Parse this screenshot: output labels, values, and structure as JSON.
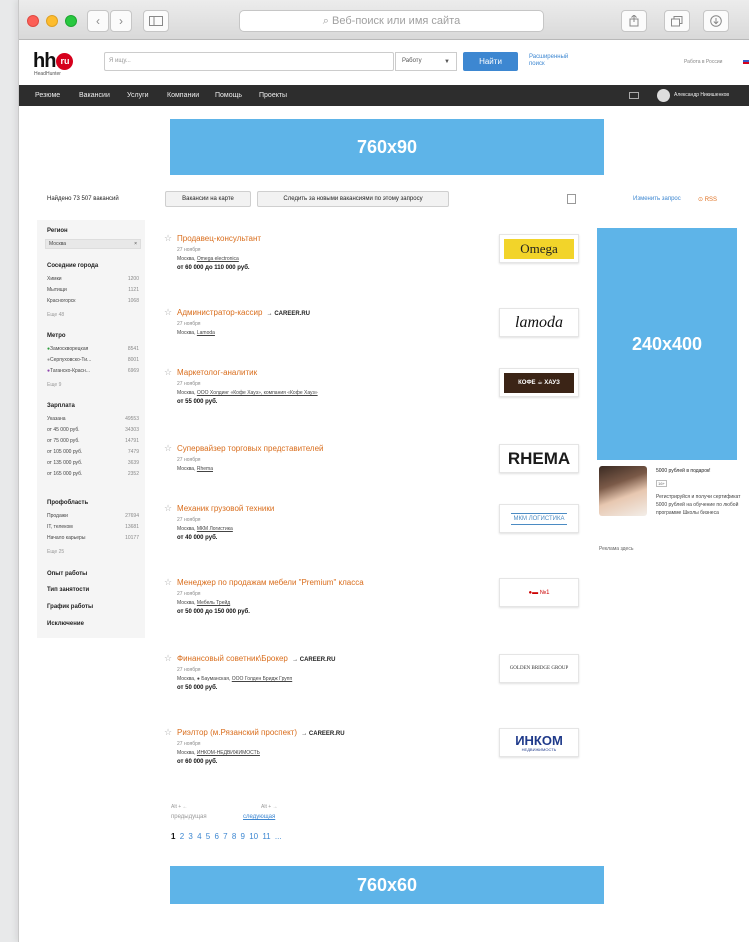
{
  "browser": {
    "address_placeholder": "Веб-поиск или имя сайта",
    "back_glyph": "‹",
    "forward_glyph": "›",
    "search_glyph": "⌕"
  },
  "header": {
    "logo_text": "hh",
    "logo_badge": "ru",
    "logo_sub": "HeadHunter",
    "search_placeholder": "Я ищу...",
    "search_type": "Работу",
    "find_button": "Найти",
    "advanced_search": "Расширенный поиск",
    "work_in_russia": "Работа в России",
    "icons": [
      "share-icon",
      "tabs-icon",
      "download-icon",
      "sidebar-icon",
      "mail-icon",
      "flag-icon"
    ]
  },
  "nav": {
    "items": [
      "Резюме",
      "Вакансии",
      "Услуги",
      "Компании",
      "Помощь",
      "Проекты"
    ],
    "user_name": "Александр Никишенков"
  },
  "banners": {
    "top": "760x90",
    "right": "240x400",
    "bottom": "760x60"
  },
  "toolbar": {
    "found": "Найдено 73 507 вакансий",
    "map_button": "Вакансии на карте",
    "follow_button": "Следить за новыми вакансиями по этому запросу",
    "change_request": "Изменить запрос",
    "rss": "RSS"
  },
  "sidebar": {
    "region_title": "Регион",
    "region_value": "Москва",
    "nearby_title": "Соседние города",
    "nearby": [
      {
        "name": "Химки",
        "count": "1200"
      },
      {
        "name": "Мытищи",
        "count": "1121"
      },
      {
        "name": "Красногорск",
        "count": "1068"
      }
    ],
    "nearby_more": "Еще 48",
    "metro_title": "Метро",
    "metro": [
      {
        "name": "Замоскворецкая",
        "count": "8541"
      },
      {
        "name": "Серпуховско-Ти...",
        "count": "8001"
      },
      {
        "name": "Таганско-Красн...",
        "count": "6969"
      }
    ],
    "metro_more": "Еще 9",
    "salary_title": "Зарплата",
    "salary": [
      {
        "name": "Указана",
        "count": "49553"
      },
      {
        "name": "от 45 000 руб.",
        "count": "34303"
      },
      {
        "name": "от 75 000 руб.",
        "count": "14791"
      },
      {
        "name": "от 105 000 руб.",
        "count": "7479"
      },
      {
        "name": "от 135 000 руб.",
        "count": "3639"
      },
      {
        "name": "от 165 000 руб.",
        "count": "2352"
      }
    ],
    "prof_title": "Профобласть",
    "prof": [
      {
        "name": "Продажи",
        "count": "27694"
      },
      {
        "name": "IT, телеком",
        "count": "13681"
      },
      {
        "name": "Начало карьеры",
        "count": "10177"
      }
    ],
    "prof_more": "Еще 25",
    "experience_title": "Опыт работы",
    "employment_title": "Тип занятости",
    "schedule_title": "График работы",
    "exclusion_title": "Исключение"
  },
  "vacancies": [
    {
      "title": "Продавец-консультант",
      "career": "",
      "date": "27 ноября",
      "city": "Москва,",
      "company": "Omega electronica",
      "salary": "от 60 000 до 110 000 руб.",
      "logo": "Omega"
    },
    {
      "title": "Администратор-кассир",
      "career": "→ CAREER.RU",
      "date": "27 ноября",
      "city": "Москва,",
      "company": "Lamoda",
      "salary": "",
      "logo": "lamoda"
    },
    {
      "title": "Маркетолог-аналитик",
      "career": "",
      "date": "27 ноября",
      "city": "Москва,",
      "company": "ООО Холдинг «Кофе Хауз», компания «Кофе Хауз»",
      "salary": "от 55 000 руб.",
      "logo": "КОФЕ ☕ ХАУЗ"
    },
    {
      "title": "Супервайзер торговых представителей",
      "career": "",
      "date": "27 ноября",
      "city": "Москва,",
      "company": "Rhema",
      "salary": "",
      "logo": "RHEMA"
    },
    {
      "title": "Механик грузовой техники",
      "career": "",
      "date": "27 ноября",
      "city": "Москва,",
      "company": "МКМ Логистика",
      "salary": "от 40 000 руб.",
      "logo": "МКМ ЛОГИСТИКА"
    },
    {
      "title": "Менеджер по продажам мебели \"Premium\" класса",
      "career": "",
      "date": "27 ноября",
      "city": "Москва,",
      "company": "Мебель Трейд",
      "salary": "от 50 000 до 150 000 руб.",
      "logo": "●▬ №1"
    },
    {
      "title": "Финансовый советник\\Брокер",
      "career": "→ CAREER.RU",
      "date": "27 ноября",
      "city": "Москва, ● Бауманская,",
      "company": "ООО Голден Бридж Групп",
      "salary": "от 50 000 руб.",
      "logo": "GOLDEN BRIDGE GROUP"
    },
    {
      "title": "Риэлтор (м.Рязанский проспект)",
      "career": "→ CAREER.RU",
      "date": "27 ноября",
      "city": "Москва,",
      "company": "ИНКОМ-НЕДВИЖИМОСТЬ",
      "salary": "от 60 000 руб.",
      "logo": "ИНКОМ"
    }
  ],
  "inkom_sub": "НЕДВИЖИМОСТЬ",
  "pager": {
    "hint_prev": "Alt + ←",
    "hint_next": "Alt + →",
    "prev": "предыдущая",
    "next": "следующая",
    "pages": [
      "1",
      "2",
      "3",
      "4",
      "5",
      "6",
      "7",
      "8",
      "9",
      "10",
      "11",
      "..."
    ]
  },
  "promo": {
    "title": "5000 рублей в подарок!",
    "badge": "16+",
    "text": "Регистрируйся и получи сертификат 5000 рублей на обучение по любой программе Школы бизнеса",
    "ad_here": "Реклама здесь"
  }
}
